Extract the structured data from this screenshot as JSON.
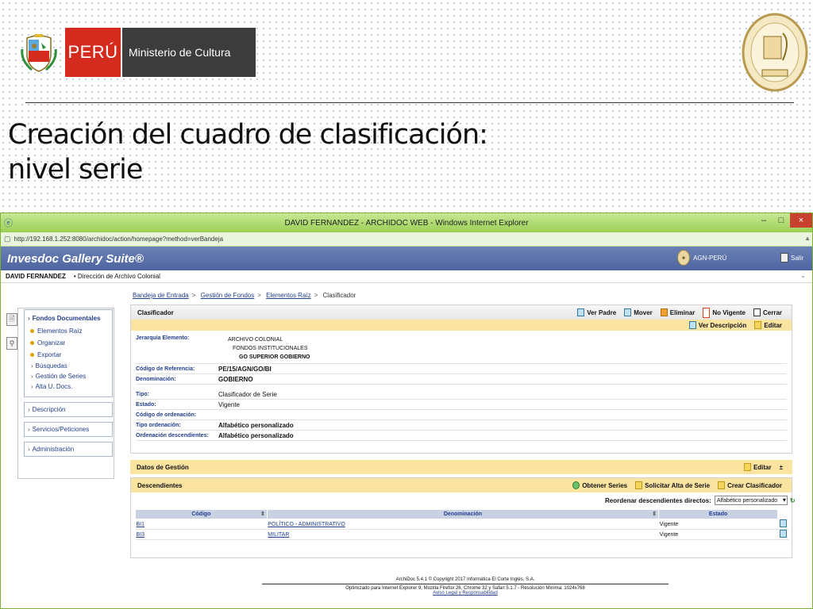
{
  "slide": {
    "peru_label": "PERÚ",
    "ministry_label": "Ministerio de Cultura",
    "title_line1": "Creación del cuadro de clasificación:",
    "title_line2": "nivel serie"
  },
  "browser": {
    "window_title": "DAVID FERNANDEZ - ARCHIDOC WEB - Windows Internet Explorer",
    "url": "http://192.168.1.252:8080/archidoc/action/homepage?method=verBandeja"
  },
  "app": {
    "brand": "Invesdoc Gallery Suite®",
    "agn_label": "AGN-PERÚ",
    "salir_label": "Salir",
    "user_name": "DAVID FERNANDEZ",
    "user_dept": "• Dirección de Archivo Colonial"
  },
  "nav": {
    "section": "Fondos Documentales",
    "items": [
      "Elementos Raíz",
      "Organizar",
      "Exportar"
    ],
    "subitems": [
      "Búsquedas",
      "Gestión de Series",
      "Alta U. Docs."
    ],
    "boxes": [
      "Descripción",
      "Servicios/Peticiones",
      "Administración"
    ]
  },
  "breadcrumb": {
    "links": [
      "Bandeja de Entrada",
      "Gestión de Fondos",
      "Elementos Raíz"
    ],
    "sep": ">",
    "current": "Clasificador"
  },
  "clasificador": {
    "title": "Clasificador",
    "actions": [
      "Ver Padre",
      "Mover",
      "Eliminar",
      "No Vigente",
      "Cerrar"
    ],
    "sub_actions": [
      "Ver Descripción",
      "Editar"
    ],
    "jerarquia_label": "Jerarquía Elemento:",
    "jerarquia": [
      "ARCHIVO COLONIAL",
      "FONDOS INSTITUCIONALES",
      "GO  SUPERIOR GOBIERNO"
    ],
    "fields": [
      {
        "label": "Código de Referencia:",
        "value": "PE/15/AGN/GO/BI"
      },
      {
        "label": "Denominación:",
        "value": "GOBIERNO"
      },
      {
        "label": "Tipo:",
        "value": "Clasificador de Serie"
      },
      {
        "label": "Estado:",
        "value": "Vigente"
      },
      {
        "label": "Código de ordenación:",
        "value": ""
      },
      {
        "label": "Tipo ordenación:",
        "value": "Alfabético personalizado"
      },
      {
        "label": "Ordenación descendientes:",
        "value": "Alfabético personalizado"
      }
    ]
  },
  "gestion": {
    "title": "Datos de Gestión",
    "edit_label": "Editar"
  },
  "descendientes": {
    "title": "Descendientes",
    "actions": [
      "Obtener Series",
      "Solicitar Alta de Serie",
      "Crear Clasificador"
    ],
    "reorder_label": "Reordenar descendientes directos:",
    "reorder_value": "Alfabético personalizado",
    "columns": [
      "Código",
      "Denominación",
      "Estado"
    ],
    "rows": [
      {
        "codigo": "BI1",
        "denominacion": "POLÍTICO - ADMINISTRATIVO",
        "estado": "Vigente"
      },
      {
        "codigo": "BI3",
        "denominacion": "MILITAR",
        "estado": "Vigente"
      }
    ]
  },
  "footer": {
    "line1": "ArchiDoc 5.4.1 © Copyright 2017 Informática El Corte Inglés, S.A.",
    "line2": "Optimizado para Internet Explorer 9, Mozilla Firefox 26, Chrome 32 y Safari 5.1.7 - Resolución Mínima: 1024x768",
    "link": "Aviso Legal y Responsabilidad"
  }
}
